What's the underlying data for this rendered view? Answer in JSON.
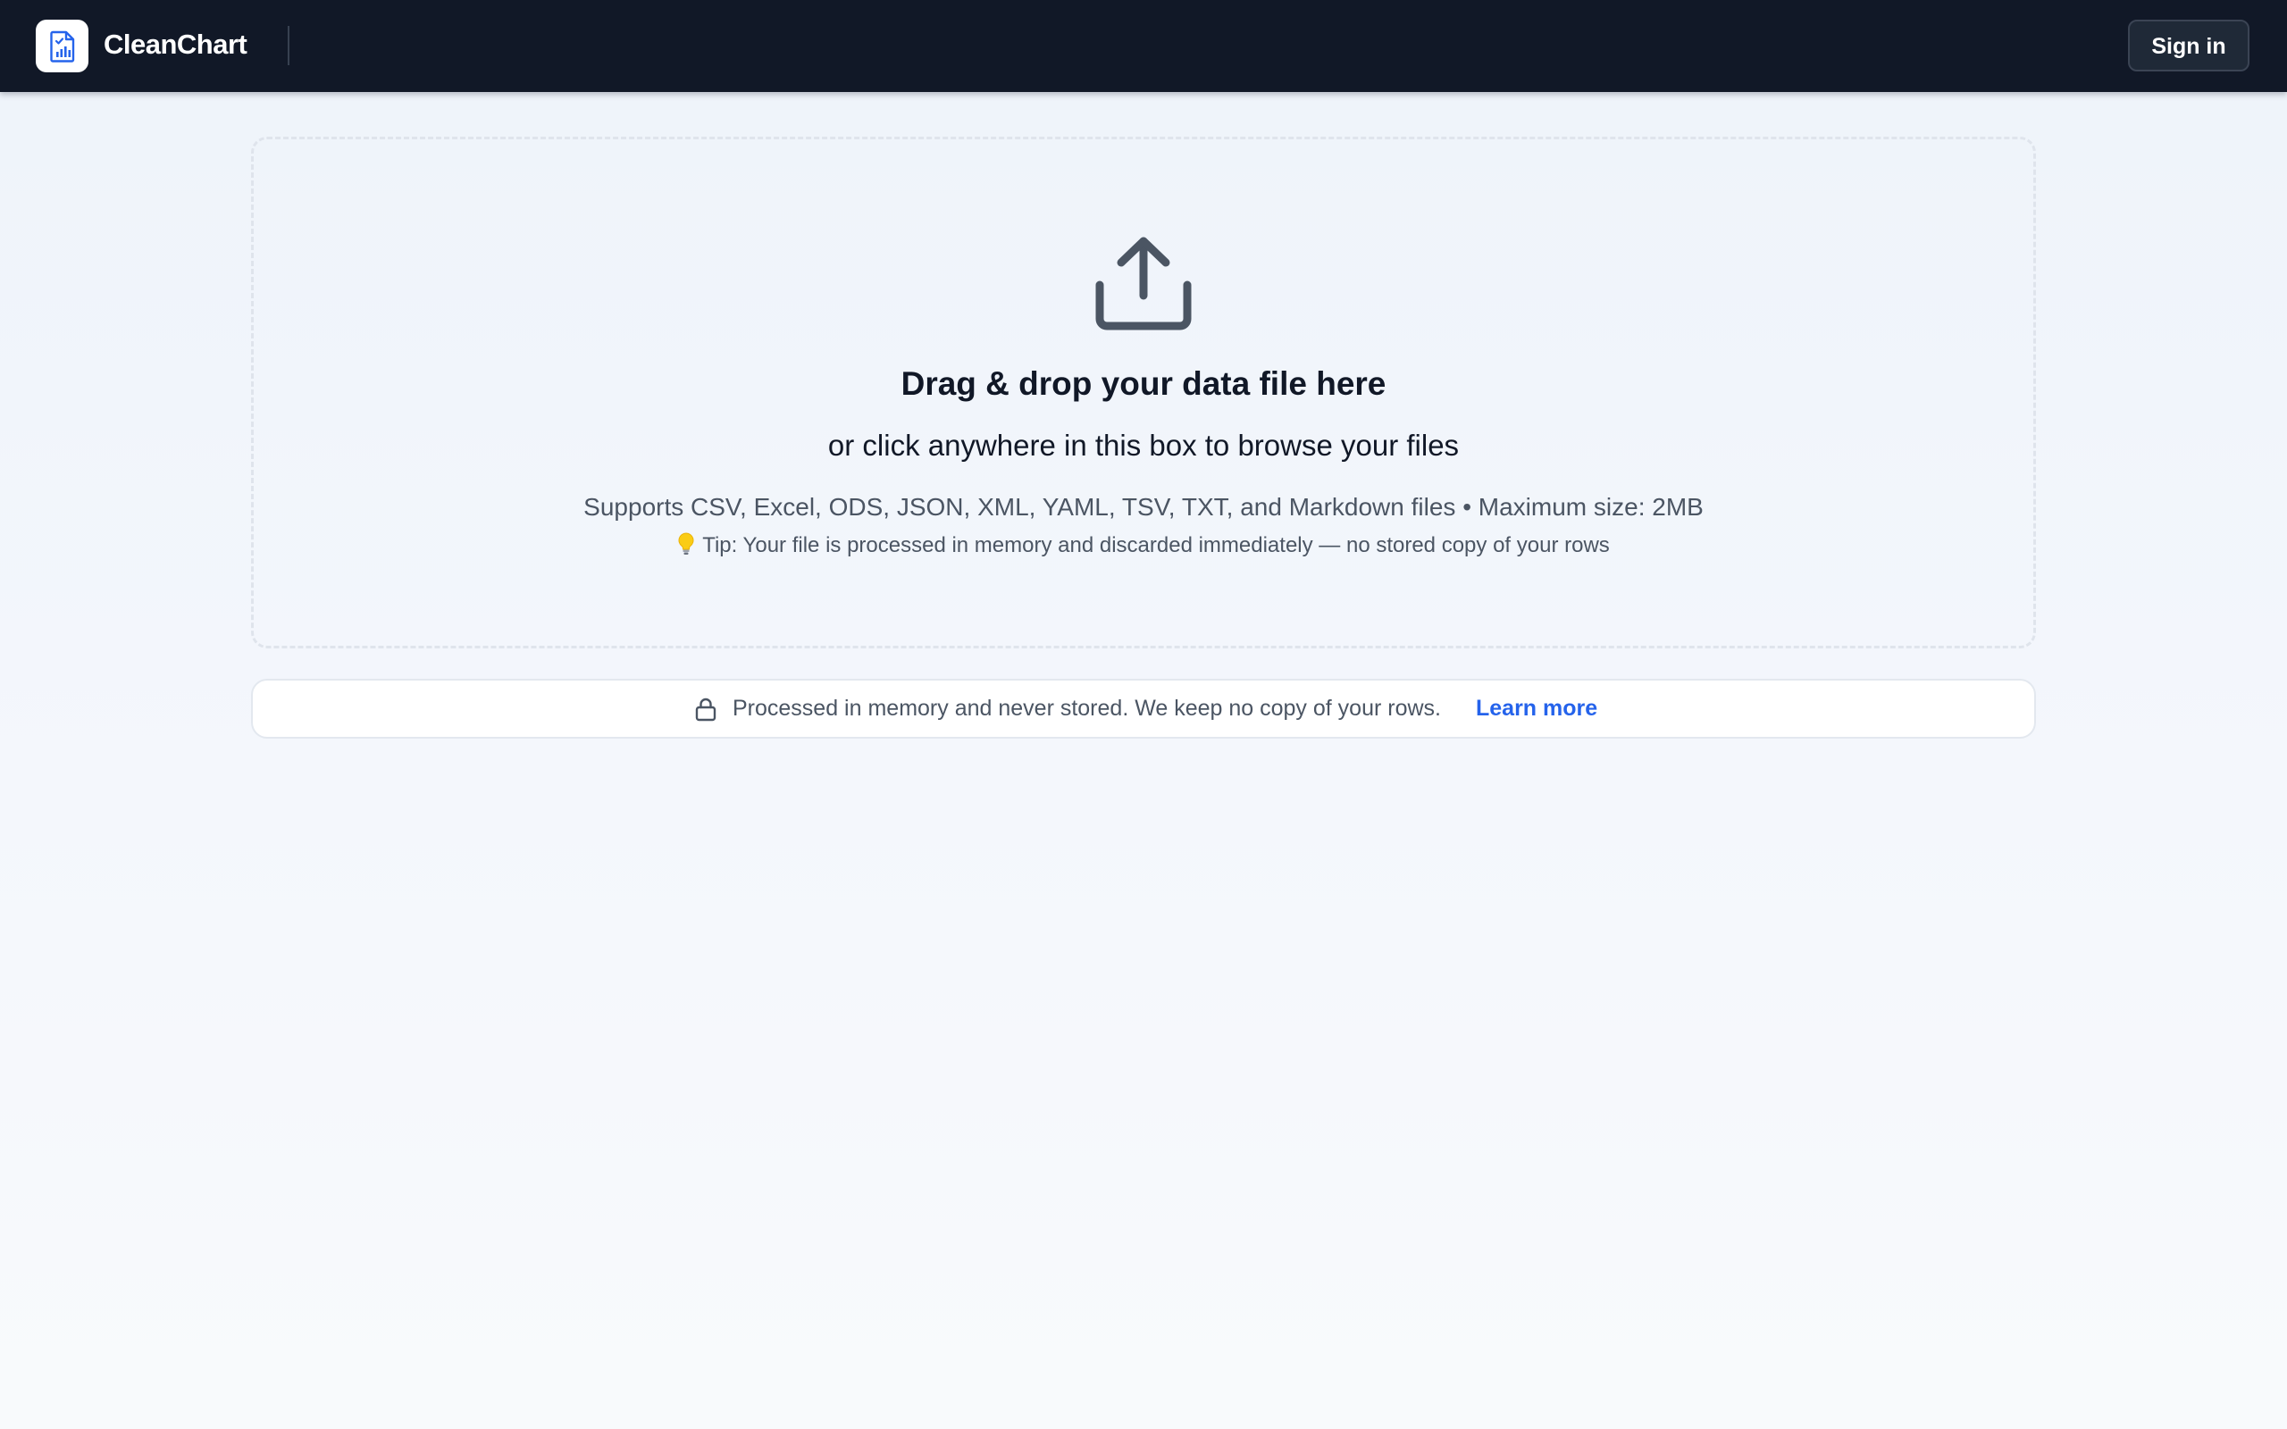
{
  "header": {
    "brand": "CleanChart",
    "logo_icon": "chart-document-icon",
    "signin_label": "Sign in"
  },
  "dropzone": {
    "icon": "upload-icon",
    "title": "Drag & drop your data file here",
    "subtitle": "or click anywhere in this box to browse your files",
    "formats": "Supports CSV, Excel, ODS, JSON, XML, YAML, TSV, TXT, and Markdown files • Maximum size: 2MB",
    "tip_icon": "lightbulb-icon",
    "tip": "Tip: Your file is processed in memory and discarded immediately — no stored copy of your rows"
  },
  "privacy": {
    "icon": "lock-icon",
    "text": "Processed in memory and never stored. We keep no copy of your rows.",
    "link_label": "Learn more"
  },
  "colors": {
    "topbar": "#111827",
    "accent_link": "#2563eb",
    "logo_accent": "#2563eb",
    "background": "#f4f7fc"
  }
}
